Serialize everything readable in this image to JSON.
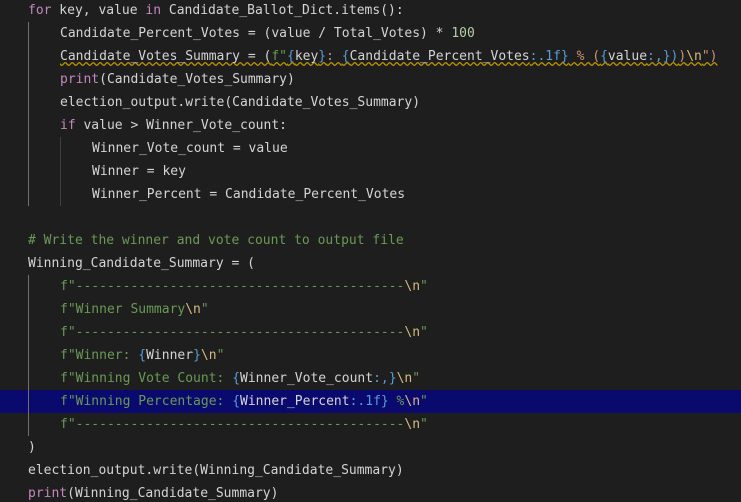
{
  "colors": {
    "background": "#1e1e1e",
    "keyword": "#c586c0",
    "function": "#dcdcaa",
    "variable": "#d4d4d4",
    "number": "#b5cea8",
    "string": "#ce9178",
    "fstring": "#6a9955",
    "brace": "#569cd6",
    "comment": "#6a9955",
    "escape": "#d7ba7d",
    "highlight": "#0a0a6e"
  },
  "lines": [
    {
      "indent": 0,
      "guides": [],
      "tokens": [
        {
          "t": "for",
          "c": "keyword"
        },
        {
          "t": " key, value ",
          "c": "variable"
        },
        {
          "t": "in",
          "c": "keyword"
        },
        {
          "t": " Candidate_Ballot_Dict.items():",
          "c": "variable"
        }
      ]
    },
    {
      "indent": 1,
      "guides": [
        1
      ],
      "tokens": [
        {
          "t": "Candidate_Percent_Votes = (value / Total_Votes) * ",
          "c": "variable"
        },
        {
          "t": "100",
          "c": "number"
        }
      ]
    },
    {
      "indent": 1,
      "guides": [
        1
      ],
      "squiggle": true,
      "tokens": [
        {
          "t": "Candidate_Votes_Summary = (",
          "c": "variable"
        },
        {
          "t": "f\"",
          "c": "fstring"
        },
        {
          "t": "{",
          "c": "brace"
        },
        {
          "t": "key",
          "c": "variable"
        },
        {
          "t": "}",
          "c": "brace"
        },
        {
          "t": ": ",
          "c": "string"
        },
        {
          "t": "{",
          "c": "brace"
        },
        {
          "t": "Candidate_Percent_Votes",
          "c": "variable"
        },
        {
          "t": ":.1f}",
          "c": "brace"
        },
        {
          "t": " % (",
          "c": "string"
        },
        {
          "t": "{",
          "c": "brace"
        },
        {
          "t": "value",
          "c": "variable"
        },
        {
          "t": ":,})",
          "c": "brace"
        },
        {
          "t": ")",
          "c": "string"
        },
        {
          "t": "\\n",
          "c": "escape"
        },
        {
          "t": "\")",
          "c": "string"
        }
      ]
    },
    {
      "indent": 1,
      "guides": [
        1
      ],
      "tokens": [
        {
          "t": "print",
          "c": "keyword"
        },
        {
          "t": "(Candidate_Votes_Summary)",
          "c": "variable"
        }
      ]
    },
    {
      "indent": 1,
      "guides": [
        1
      ],
      "tokens": [
        {
          "t": "election_output.write(Candidate_Votes_Summary)",
          "c": "variable"
        }
      ]
    },
    {
      "indent": 1,
      "guides": [
        1
      ],
      "tokens": [
        {
          "t": "if",
          "c": "keyword"
        },
        {
          "t": " value > Winner_Vote_count:",
          "c": "variable"
        }
      ]
    },
    {
      "indent": 2,
      "guides": [
        1,
        2
      ],
      "tokens": [
        {
          "t": "Winner_Vote_count = value",
          "c": "variable"
        }
      ]
    },
    {
      "indent": 2,
      "guides": [
        1,
        2
      ],
      "tokens": [
        {
          "t": "Winner = key",
          "c": "variable"
        }
      ]
    },
    {
      "indent": 2,
      "guides": [
        1,
        2
      ],
      "tokens": [
        {
          "t": "Winner_Percent = Candidate_Percent_Votes",
          "c": "variable"
        }
      ]
    },
    {
      "indent": 0,
      "guides": [],
      "tokens": []
    },
    {
      "indent": 0,
      "guides": [],
      "tokens": [
        {
          "t": "# Write the winner and vote count to output file",
          "c": "comment"
        }
      ]
    },
    {
      "indent": 0,
      "guides": [],
      "tokens": [
        {
          "t": "Winning_Candidate_Summary = (",
          "c": "variable"
        }
      ]
    },
    {
      "indent": 1,
      "guides": [
        1
      ],
      "tokens": [
        {
          "t": "f\"------------------------------------------",
          "c": "fstring"
        },
        {
          "t": "\\n",
          "c": "escape"
        },
        {
          "t": "\"",
          "c": "fstring"
        }
      ]
    },
    {
      "indent": 1,
      "guides": [
        1
      ],
      "tokens": [
        {
          "t": "f\"Winner Summary",
          "c": "fstring"
        },
        {
          "t": "\\n",
          "c": "escape"
        },
        {
          "t": "\"",
          "c": "fstring"
        }
      ]
    },
    {
      "indent": 1,
      "guides": [
        1
      ],
      "tokens": [
        {
          "t": "f\"------------------------------------------",
          "c": "fstring"
        },
        {
          "t": "\\n",
          "c": "escape"
        },
        {
          "t": "\"",
          "c": "fstring"
        }
      ]
    },
    {
      "indent": 1,
      "guides": [
        1
      ],
      "tokens": [
        {
          "t": "f\"Winner: ",
          "c": "fstring"
        },
        {
          "t": "{",
          "c": "brace"
        },
        {
          "t": "Winner",
          "c": "variable"
        },
        {
          "t": "}",
          "c": "brace"
        },
        {
          "t": "\\n",
          "c": "escape"
        },
        {
          "t": "\"",
          "c": "fstring"
        }
      ]
    },
    {
      "indent": 1,
      "guides": [
        1
      ],
      "tokens": [
        {
          "t": "f\"Winning Vote Count: ",
          "c": "fstring"
        },
        {
          "t": "{",
          "c": "brace"
        },
        {
          "t": "Winner_Vote_count",
          "c": "variable"
        },
        {
          "t": ":,}",
          "c": "brace"
        },
        {
          "t": "\\n",
          "c": "escape"
        },
        {
          "t": "\"",
          "c": "fstring"
        }
      ]
    },
    {
      "indent": 1,
      "guides": [
        1
      ],
      "highlight": true,
      "tokens": [
        {
          "t": "f\"Winning Percentage: ",
          "c": "fstring"
        },
        {
          "t": "{",
          "c": "brace"
        },
        {
          "t": "Winner_Percent",
          "c": "variable"
        },
        {
          "t": ":.1f}",
          "c": "brace"
        },
        {
          "t": " %",
          "c": "fstring"
        },
        {
          "t": "\\n",
          "c": "escape"
        },
        {
          "t": "\"",
          "c": "fstring"
        }
      ]
    },
    {
      "indent": 1,
      "guides": [
        1
      ],
      "tokens": [
        {
          "t": "f\"------------------------------------------",
          "c": "fstring"
        },
        {
          "t": "\\n",
          "c": "escape"
        },
        {
          "t": "\"",
          "c": "fstring"
        }
      ]
    },
    {
      "indent": 0,
      "guides": [],
      "tokens": [
        {
          "t": ")",
          "c": "variable"
        }
      ]
    },
    {
      "indent": 0,
      "guides": [],
      "tokens": [
        {
          "t": "election_output.write(Winning_Candidate_Summary)",
          "c": "variable"
        }
      ]
    },
    {
      "indent": 0,
      "guides": [],
      "tokens": [
        {
          "t": "print",
          "c": "keyword"
        },
        {
          "t": "(Winning_Candidate_Summary)",
          "c": "variable"
        }
      ]
    }
  ]
}
